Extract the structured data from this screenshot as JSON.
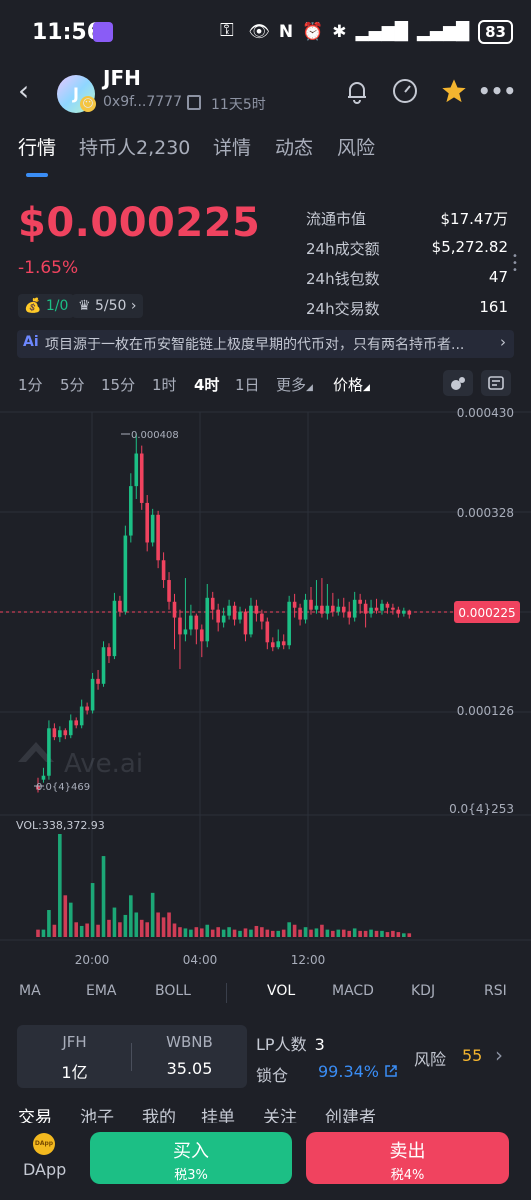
{
  "status_bar": {
    "time": "11:56",
    "battery": "83"
  },
  "header": {
    "token_name": "JFH",
    "avatar_letter": "J",
    "address": "0x9f...7777",
    "age": "11天5时"
  },
  "tabs": [
    "行情",
    "持币人2,230",
    "详情",
    "动态",
    "风险"
  ],
  "price": {
    "value": "$0.000225",
    "change": "-1.65%",
    "chip1": "1/0",
    "chip2": "5/50"
  },
  "stats": [
    {
      "label": "流通市值",
      "value": "$17.47万"
    },
    {
      "label": "24h成交额",
      "value": "$5,272.82"
    },
    {
      "label": "24h钱包数",
      "value": "47"
    },
    {
      "label": "24h交易数",
      "value": "161"
    }
  ],
  "ai_bar": {
    "badge": "Ai",
    "text": "项目源于一枚在币安智能链上极度早期的代币对，只有两名持币者..."
  },
  "timeframes": [
    "1分",
    "5分",
    "15分",
    "1时",
    "4时",
    "1日",
    "更多",
    "价格"
  ],
  "active_timeframe": "4时",
  "chart_data": {
    "type": "candlestick",
    "y_ticks": [
      "0.000430",
      "0.000328",
      "0.000225",
      "0.000126",
      "0.0{4}253"
    ],
    "current_price_label": "0.000225",
    "high_label": "0.000408",
    "low_label": "0.0{4}469",
    "watermark": "Ave.ai",
    "volume_label": "VOL:338,372.93",
    "x_ticks": [
      "20:00",
      "04:00",
      "12:00"
    ],
    "candles": [
      [
        5.2e-05,
        4.8e-05,
        6e-05,
        4.5e-05
      ],
      [
        5.8e-05,
        6.2e-05,
        7e-05,
        5.5e-05
      ],
      [
        6.2e-05,
        0.00011,
        0.000118,
        5.8e-05
      ],
      [
        0.00011,
        0.000101,
        0.000115,
        9.8e-05
      ],
      [
        0.000101,
        0.000108,
        0.000112,
        9.6e-05
      ],
      [
        0.000108,
        0.000103,
        0.00011,
        9.9e-05
      ],
      [
        0.000103,
        0.000118,
        0.000124,
        0.0001
      ],
      [
        0.000118,
        0.000113,
        0.000121,
        0.00011
      ],
      [
        0.000113,
        0.000132,
        0.000139,
        0.00011
      ],
      [
        0.000132,
        0.000128,
        0.000136,
        0.000124
      ],
      [
        0.000128,
        0.00016,
        0.000166,
        0.000125
      ],
      [
        0.00016,
        0.000155,
        0.000169,
        0.000149
      ],
      [
        0.000155,
        0.000192,
        0.000198,
        0.000152
      ],
      [
        0.000192,
        0.000183,
        0.000196,
        0.000176
      ],
      [
        0.000183,
        0.000239,
        0.000247,
        0.00018
      ],
      [
        0.000239,
        0.000228,
        0.000244,
        0.000223
      ],
      [
        0.000228,
        0.000305,
        0.000315,
        0.000225
      ],
      [
        0.000305,
        0.000355,
        0.000368,
        0.000298
      ],
      [
        0.000355,
        0.000388,
        0.000408,
        0.000342
      ],
      [
        0.000388,
        0.000338,
        0.000396,
        0.000331
      ],
      [
        0.000338,
        0.000298,
        0.000346,
        0.000289
      ],
      [
        0.000298,
        0.000326,
        0.000332,
        0.000294
      ],
      [
        0.000326,
        0.00028,
        0.00033,
        0.000272
      ],
      [
        0.00028,
        0.00026,
        0.000288,
        0.000252
      ],
      [
        0.00026,
        0.000238,
        0.000268,
        0.00023
      ],
      [
        0.000238,
        0.000222,
        0.000246,
        0.00019
      ],
      [
        0.000222,
        0.000205,
        0.00023,
        0.00017
      ],
      [
        0.000205,
        0.00021,
        0.000262,
        0.000198
      ],
      [
        0.00021,
        0.000224,
        0.000235,
        0.000204
      ],
      [
        0.000224,
        0.00021,
        0.000226,
        0.000195
      ],
      [
        0.00021,
        0.000198,
        0.000215,
        0.000182
      ],
      [
        0.000198,
        0.000242,
        0.000256,
        0.000192
      ],
      [
        0.000242,
        0.00023,
        0.000248,
        0.00022
      ],
      [
        0.00023,
        0.000217,
        0.000236,
        0.000208
      ],
      [
        0.000217,
        0.000224,
        0.000232,
        0.000212
      ],
      [
        0.000224,
        0.000234,
        0.00024,
        0.00022
      ],
      [
        0.000234,
        0.00022,
        0.000238,
        0.000214
      ],
      [
        0.00022,
        0.000228,
        0.000233,
        0.000216
      ],
      [
        0.000228,
        0.000205,
        0.000231,
        0.000198
      ],
      [
        0.000205,
        0.000234,
        0.000242,
        0.000202
      ],
      [
        0.000234,
        0.000226,
        0.00024,
        0.000218
      ],
      [
        0.000226,
        0.000218,
        0.00023,
        0.00021
      ],
      [
        0.000218,
        0.000197,
        0.000222,
        0.00019
      ],
      [
        0.000197,
        0.000192,
        0.000202,
        0.000188
      ],
      [
        0.000192,
        0.000198,
        0.00021,
        0.00019
      ],
      [
        0.000198,
        0.000194,
        0.000205,
        0.00019
      ],
      [
        0.000194,
        0.000238,
        0.000244,
        0.00019
      ],
      [
        0.000238,
        0.000232,
        0.000246,
        0.000222
      ],
      [
        0.000232,
        0.00022,
        0.000236,
        0.000214
      ],
      [
        0.00022,
        0.00024,
        0.000246,
        0.000216
      ],
      [
        0.00024,
        0.00023,
        0.000253,
        0.000225
      ],
      [
        0.00023,
        0.000234,
        0.00026,
        0.000226
      ],
      [
        0.000234,
        0.000226,
        0.000262,
        0.000222
      ],
      [
        0.000226,
        0.000234,
        0.000256,
        0.00022
      ],
      [
        0.000234,
        0.000228,
        0.000247,
        0.000223
      ],
      [
        0.000228,
        0.000233,
        0.000241,
        0.000224
      ],
      [
        0.000233,
        0.000228,
        0.000242,
        0.000222
      ],
      [
        0.000228,
        0.000222,
        0.000238,
        0.000215
      ],
      [
        0.000222,
        0.00024,
        0.000248,
        0.000218
      ],
      [
        0.00024,
        0.000236,
        0.000246,
        0.000226
      ],
      [
        0.000236,
        0.000226,
        0.00024,
        0.000212
      ],
      [
        0.000226,
        0.000232,
        0.00024,
        0.000222
      ],
      [
        0.000232,
        0.000229,
        0.000241,
        0.000226
      ],
      [
        0.000229,
        0.000236,
        0.00024,
        0.000225
      ],
      [
        0.000236,
        0.000232,
        0.000238,
        0.000226
      ],
      [
        0.000232,
        0.00023,
        0.000236,
        0.000225
      ],
      [
        0.00023,
        0.000226,
        0.000233,
        0.000222
      ],
      [
        0.000226,
        0.000229,
        0.000232,
        0.000223
      ],
      [
        0.000229,
        0.000225,
        0.00023,
        0.000221
      ]
    ],
    "volumes": [
      6,
      6,
      22,
      10,
      84,
      34,
      28,
      12,
      9,
      11,
      44,
      10,
      66,
      14,
      24,
      12,
      18,
      34,
      20,
      14,
      12,
      36,
      20,
      16,
      20,
      11,
      8,
      7,
      6,
      8,
      7,
      10,
      6,
      8,
      6,
      8,
      6,
      5,
      7,
      6,
      9,
      8,
      6,
      5,
      5,
      6,
      12,
      10,
      6,
      8,
      6,
      7,
      10,
      6,
      5,
      6,
      6,
      5,
      7,
      5,
      5,
      6,
      5,
      5,
      4,
      5,
      4,
      3,
      3
    ]
  },
  "indicators": [
    "MA",
    "EMA",
    "BOLL",
    "VOL",
    "MACD",
    "KDJ",
    "RSI"
  ],
  "active_indicator": "VOL",
  "pair": {
    "base": "JFH",
    "base_amount": "1亿",
    "quote": "WBNB",
    "quote_amount": "35.05"
  },
  "lp": {
    "count_label": "LP人数",
    "count": "3",
    "lock_label": "锁仓",
    "lock_value": "99.34%"
  },
  "risk": {
    "label": "风险",
    "score": "55"
  },
  "bottom_tabs": [
    "交易",
    "池子",
    "我的",
    "挂单",
    "关注",
    "创建者"
  ],
  "actions": {
    "dapp_label": "DApp",
    "buy_label": "买入",
    "buy_tax": "税3%",
    "sell_label": "卖出",
    "sell_tax": "税4%"
  },
  "colors": {
    "up": "#1cbf85",
    "down": "#f0435f",
    "accent": "#3a8df5",
    "background": "#1e2027"
  }
}
